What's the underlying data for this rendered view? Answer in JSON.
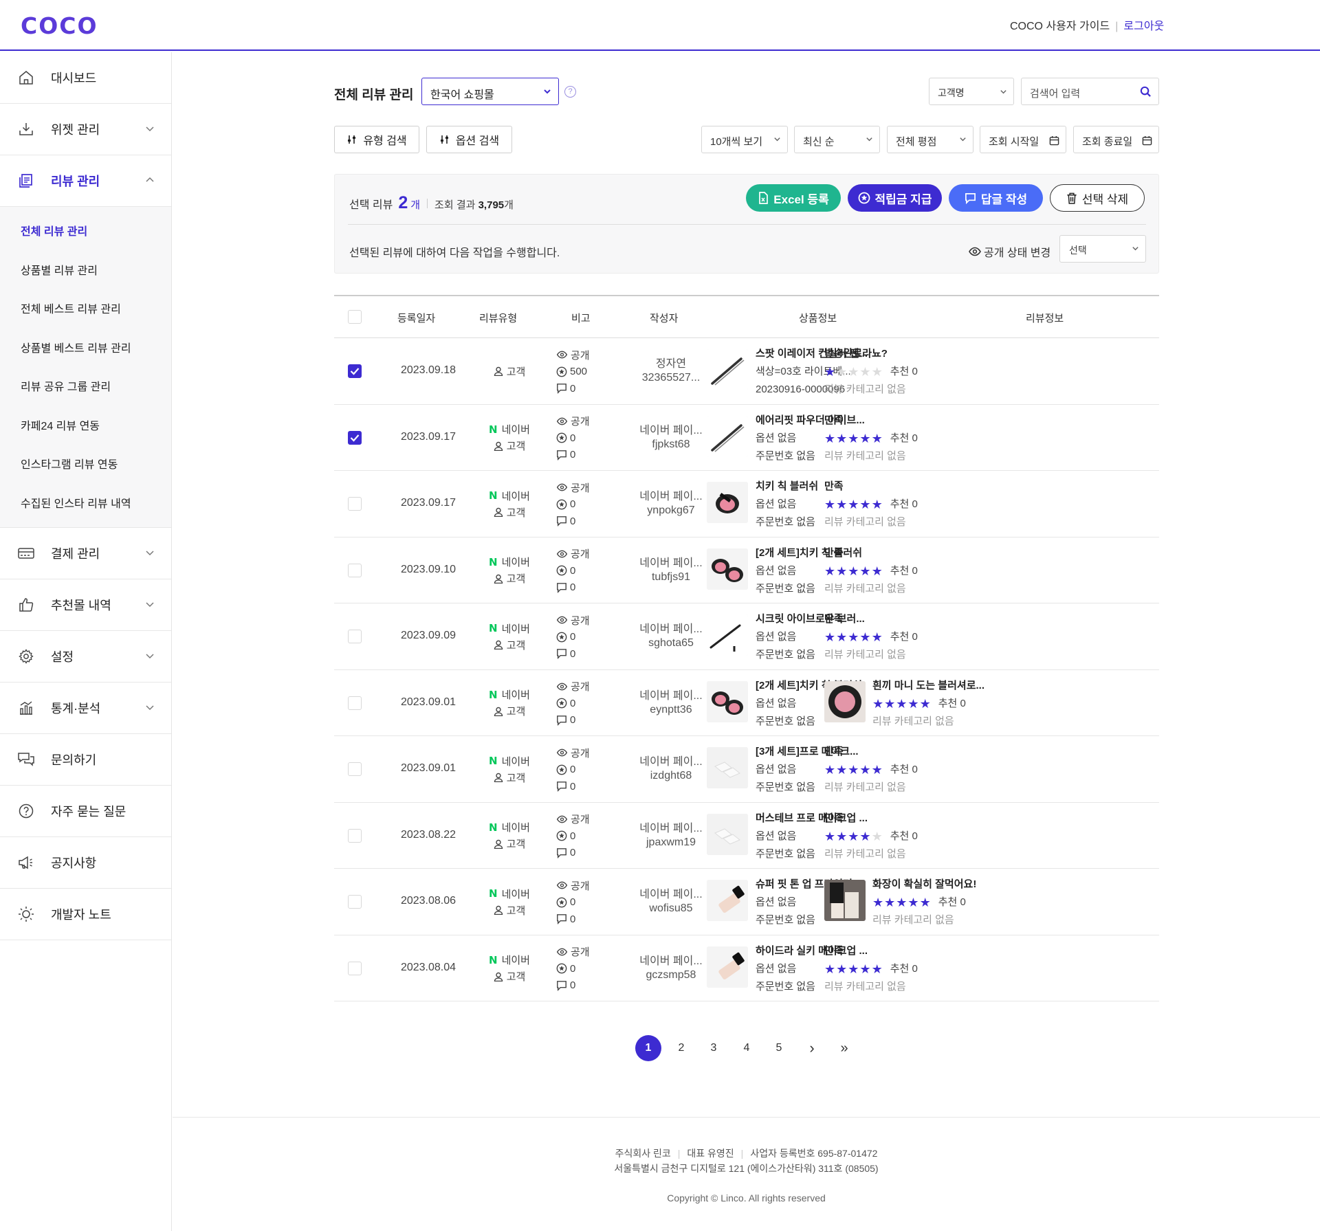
{
  "header": {
    "logo": "COCO",
    "guide": "COCO 사용자 가이드",
    "logout": "로그아웃"
  },
  "sidebar": {
    "items": [
      {
        "label": "대시보드",
        "icon": "home-icon",
        "expandable": false
      },
      {
        "label": "위젯 관리",
        "icon": "download-icon",
        "expandable": true
      },
      {
        "label": "리뷰 관리",
        "icon": "review-doc-icon",
        "expandable": true,
        "expanded": true
      },
      {
        "label": "결제 관리",
        "icon": "card-icon",
        "expandable": true
      },
      {
        "label": "추천몰 내역",
        "icon": "thumbs-up-icon",
        "expandable": true
      },
      {
        "label": "설정",
        "icon": "gear-icon",
        "expandable": true
      },
      {
        "label": "통계·분석",
        "icon": "chart-icon",
        "expandable": true
      },
      {
        "label": "문의하기",
        "icon": "chat-icon",
        "expandable": false
      },
      {
        "label": "자주 묻는 질문",
        "icon": "question-icon",
        "expandable": false
      },
      {
        "label": "공지사항",
        "icon": "megaphone-icon",
        "expandable": false
      },
      {
        "label": "개발자 노트",
        "icon": "bulb-icon",
        "expandable": false
      }
    ],
    "submenu": [
      "전체 리뷰 관리",
      "상품별 리뷰 관리",
      "전체 베스트 리뷰 관리",
      "상품별 베스트 리뷰 관리",
      "리뷰 공유 그룹 관리",
      "카페24 리뷰 연동",
      "인스타그램 리뷰 연동",
      "수집된 인스타 리뷰 내역"
    ]
  },
  "toolbar": {
    "page_title": "전체 리뷰 관리",
    "mall_select": "한국어 쇼핑몰",
    "help": "?",
    "customer_select": "고객명",
    "search_placeholder": "검색어 입력",
    "type_search": "유형 검색",
    "option_search": "옵션 검색",
    "per_page": "10개씩 보기",
    "sort": "최신 순",
    "rating": "전체 평점",
    "start_date": "조회 시작일",
    "end_date": "조회 종료일"
  },
  "actions": {
    "selected_label": "선택 리뷰",
    "selected_count": "2",
    "selected_unit": "개",
    "result_label": "조회 결과",
    "result_count": "3,795",
    "result_unit": "개",
    "excel": "Excel 등록",
    "points": "적립금 지급",
    "reply": "답글 작성",
    "delete": "선택 삭제",
    "description": "선택된 리뷰에 대하여 다음 작업을 수행합니다.",
    "visibility_label": "공개 상태 변경",
    "visibility_select": "선택",
    "colors": {
      "excel": "#1fb58f",
      "points": "#3d2bd1",
      "reply": "#4a6cf7",
      "accent": "#3d2bd1"
    }
  },
  "table": {
    "headers": [
      "등록일자",
      "리뷰유형",
      "비고",
      "작성자",
      "상품정보",
      "리뷰정보"
    ],
    "rows": [
      {
        "checked": true,
        "date": "2023.09.18",
        "naver": "",
        "type": "고객",
        "visibility": "공개",
        "points": "500",
        "comments": "0",
        "author1": "정자연",
        "author2": "32365527...",
        "product_image": "brush-pencil",
        "product_name": "스팟 이레이저 컨실러 펜...",
        "option": "색상=03호 라이트베...",
        "order": "20230916-0000096",
        "review_image": "",
        "review_title": "발송완료라뇨?",
        "rating": 1,
        "reco": "추천 0",
        "category": "리뷰 카테고리 없음"
      },
      {
        "checked": true,
        "date": "2023.09.17",
        "naver": "N",
        "naver_label": "네이버",
        "type": "고객",
        "visibility": "공개",
        "points": "0",
        "comments": "0",
        "author1": "네이버 페이...",
        "author2": "fjpkst68",
        "product_image": "brush-pencil",
        "product_name": "에어리핏 파우더 아이브...",
        "option": "옵션 없음",
        "order": "주문번호 없음",
        "review_image": "",
        "review_title": "만족",
        "rating": 5,
        "reco": "추천 0",
        "category": "리뷰 카테고리 없음"
      },
      {
        "checked": false,
        "date": "2023.09.17",
        "naver": "N",
        "naver_label": "네이버",
        "type": "고객",
        "visibility": "공개",
        "points": "0",
        "comments": "0",
        "author1": "네이버 페이...",
        "author2": "ynpokg67",
        "product_image": "blush-single",
        "product_name": "치키 칙 블러쉬",
        "option": "옵션 없음",
        "order": "주문번호 없음",
        "review_image": "",
        "review_title": "만족",
        "rating": 5,
        "reco": "추천 0",
        "category": "리뷰 카테고리 없음"
      },
      {
        "checked": false,
        "date": "2023.09.10",
        "naver": "N",
        "naver_label": "네이버",
        "type": "고객",
        "visibility": "공개",
        "points": "0",
        "comments": "0",
        "author1": "네이버 페이...",
        "author2": "tubfjs91",
        "product_image": "blush-double",
        "product_name": "[2개 세트]치키 칙 블러쉬",
        "option": "옵션 없음",
        "order": "주문번호 없음",
        "review_image": "",
        "review_title": "만족",
        "rating": 5,
        "reco": "추천 0",
        "category": "리뷰 카테고리 없음"
      },
      {
        "checked": false,
        "date": "2023.09.09",
        "naver": "N",
        "naver_label": "네이버",
        "type": "고객",
        "visibility": "공개",
        "points": "0",
        "comments": "0",
        "author1": "네이버 페이...",
        "author2": "sghota65",
        "product_image": "eyeliner",
        "product_name": "시크릿 아이브로우 브러...",
        "option": "옵션 없음",
        "order": "주문번호 없음",
        "review_image": "",
        "review_title": "만족",
        "rating": 5,
        "reco": "추천 0",
        "category": "리뷰 카테고리 없음"
      },
      {
        "checked": false,
        "date": "2023.09.01",
        "naver": "N",
        "naver_label": "네이버",
        "type": "고객",
        "visibility": "공개",
        "points": "0",
        "comments": "0",
        "author1": "네이버 페이...",
        "author2": "eynptt36",
        "product_image": "blush-double",
        "product_name": "[2개 세트]치키 칙 블러쉬",
        "option": "옵션 없음",
        "order": "주문번호 없음",
        "review_image": "blush-photo",
        "review_title": "흰끼 마니 도는 블러셔로...",
        "rating": 5,
        "reco": "추천 0",
        "category": "리뷰 카테고리 없음"
      },
      {
        "checked": false,
        "date": "2023.09.01",
        "naver": "N",
        "naver_label": "네이버",
        "type": "고객",
        "visibility": "공개",
        "points": "0",
        "comments": "0",
        "author1": "네이버 페이...",
        "author2": "izdght68",
        "product_image": "sponge",
        "product_name": "[3개 세트]프로 메이크...",
        "option": "옵션 없음",
        "order": "주문번호 없음",
        "review_image": "",
        "review_title": "만족",
        "rating": 5,
        "reco": "추천 0",
        "category": "리뷰 카테고리 없음"
      },
      {
        "checked": false,
        "date": "2023.08.22",
        "naver": "N",
        "naver_label": "네이버",
        "type": "고객",
        "visibility": "공개",
        "points": "0",
        "comments": "0",
        "author1": "네이버 페이...",
        "author2": "jpaxwm19",
        "product_image": "sponge",
        "product_name": "머스테브 프로 메이크업 ...",
        "option": "옵션 없음",
        "order": "주문번호 없음",
        "review_image": "",
        "review_title": "만족",
        "rating": 4,
        "reco": "추천 0",
        "category": "리뷰 카테고리 없음"
      },
      {
        "checked": false,
        "date": "2023.08.06",
        "naver": "N",
        "naver_label": "네이버",
        "type": "고객",
        "visibility": "공개",
        "points": "0",
        "comments": "0",
        "author1": "네이버 페이...",
        "author2": "wofisu85",
        "product_image": "primer",
        "product_name": "슈퍼 핏 톤 업 프라이머",
        "option": "옵션 없음",
        "order": "주문번호 없음",
        "review_image": "primer-photo",
        "review_title": "화장이 확실히 잘먹어요!",
        "rating": 5,
        "reco": "추천 0",
        "category": "리뷰 카테고리 없음"
      },
      {
        "checked": false,
        "date": "2023.08.04",
        "naver": "N",
        "naver_label": "네이버",
        "type": "고객",
        "visibility": "공개",
        "points": "0",
        "comments": "0",
        "author1": "네이버 페이...",
        "author2": "gczsmp58",
        "product_image": "primer",
        "product_name": "하이드라 실키 메이크업 ...",
        "option": "옵션 없음",
        "order": "주문번호 없음",
        "review_image": "",
        "review_title": "만족",
        "rating": 5,
        "reco": "추천 0",
        "category": "리뷰 카테고리 없음"
      }
    ]
  },
  "pagination": {
    "pages": [
      "1",
      "2",
      "3",
      "4",
      "5"
    ],
    "current": "1",
    "next": "›",
    "last": "»"
  },
  "footer": {
    "company": "주식회사 린코",
    "ceo": "대표 유영진",
    "biz_no": "사업자 등록번호 695-87-01472",
    "address": "서울특별시 금천구 디지털로 121 (에이스가산타워) 311호 (08505)",
    "copyright": "Copyright © Linco. All rights reserved"
  }
}
